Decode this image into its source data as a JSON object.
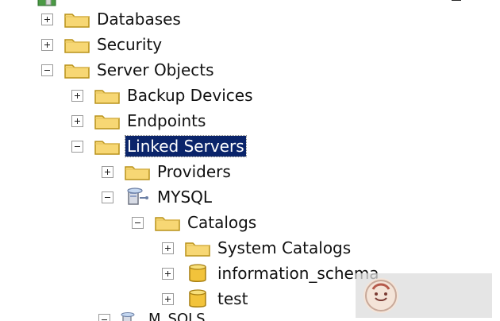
{
  "colors": {
    "selection_bg": "#0a246a",
    "selection_text": "#ffffff",
    "folder_fill": "#f7d774",
    "folder_stroke": "#b9921a",
    "db_fill": "#f2c33b",
    "db_stroke": "#a77f12"
  },
  "tree": {
    "nodes": [
      {
        "label": "Databases",
        "icon": "folder-icon",
        "toggle": "plus"
      },
      {
        "label": "Security",
        "icon": "folder-icon",
        "toggle": "plus"
      },
      {
        "label": "Server Objects",
        "icon": "folder-icon",
        "toggle": "minus"
      },
      {
        "label": "Backup Devices",
        "icon": "folder-icon",
        "toggle": "plus"
      },
      {
        "label": "Endpoints",
        "icon": "folder-icon",
        "toggle": "plus"
      },
      {
        "label": "Linked Servers",
        "icon": "folder-icon",
        "toggle": "minus",
        "selected": true
      },
      {
        "label": "Providers",
        "icon": "folder-icon",
        "toggle": "plus"
      },
      {
        "label": "MYSQL",
        "icon": "linked-server-icon",
        "toggle": "minus"
      },
      {
        "label": "Catalogs",
        "icon": "folder-icon",
        "toggle": "minus"
      },
      {
        "label": "System Catalogs",
        "icon": "folder-icon",
        "toggle": "plus"
      },
      {
        "label": "information_schema",
        "icon": "database-icon",
        "toggle": "plus"
      },
      {
        "label": "test",
        "icon": "database-icon",
        "toggle": "plus"
      }
    ]
  },
  "partial_bottom": {
    "label": "M_SQLS..."
  }
}
